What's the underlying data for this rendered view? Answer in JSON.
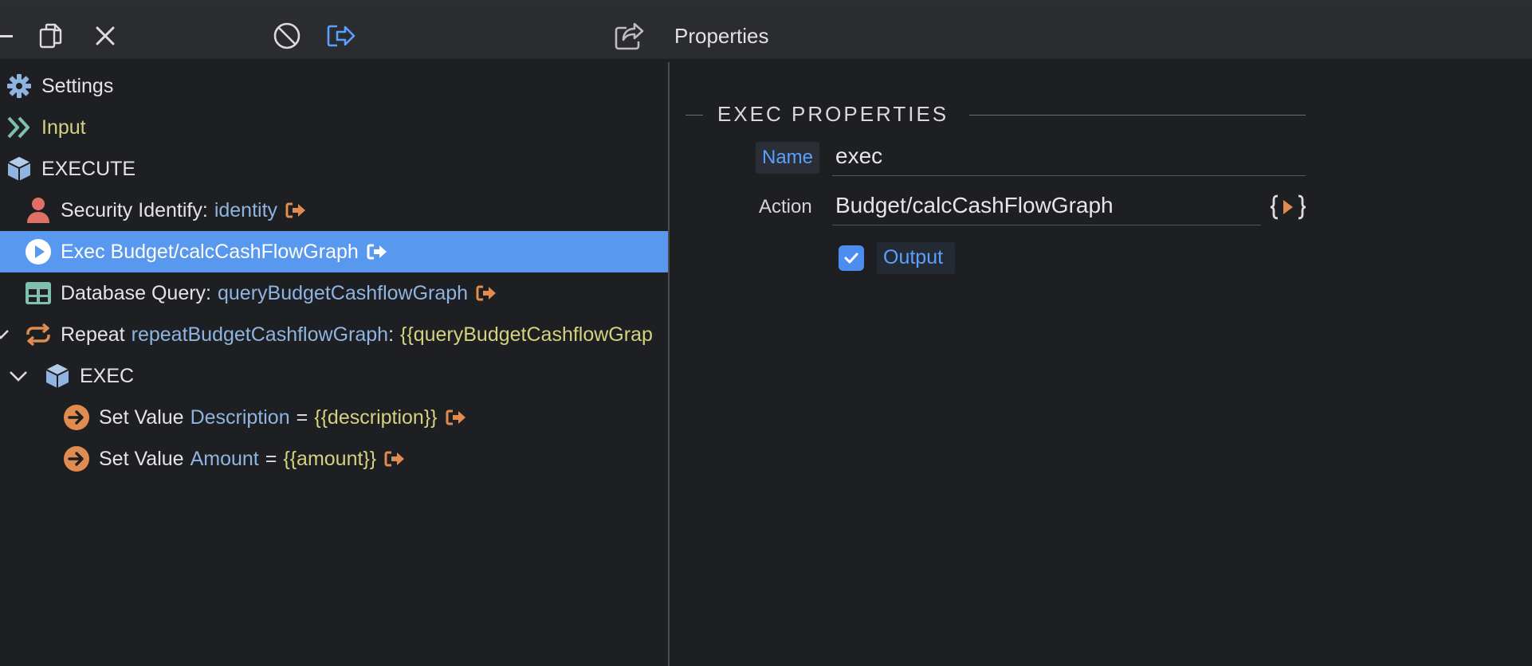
{
  "toolbar": {
    "icons": [
      "minus-icon",
      "copy-icon",
      "close-icon",
      "disable-icon",
      "export-icon",
      "share-icon"
    ],
    "properties_title": "Properties"
  },
  "tree": [
    {
      "label": "Settings",
      "icon": "gear-icon"
    },
    {
      "label": "Input",
      "icon": "double-chevron-right-icon"
    },
    {
      "label": "EXECUTE",
      "icon": "cube-icon"
    },
    {
      "label": "Security Identify:",
      "value": "identity",
      "icon": "user-icon"
    },
    {
      "label": "Exec Budget/calcCashFlowGraph",
      "icon": "play-circle-icon",
      "selected": true
    },
    {
      "label": "Database Query:",
      "value": "queryBudgetCashflowGraph",
      "icon": "table-icon"
    },
    {
      "label": "Repeat",
      "value": "repeatBudgetCashflowGraph",
      "sep": ":",
      "value2": "{{queryBudgetCashflowGrap",
      "icon": "repeat-icon"
    },
    {
      "label": "EXEC",
      "icon": "cube-icon"
    },
    {
      "label": "Set Value",
      "value": "Description",
      "sep": "=",
      "value2": "{{description}}",
      "icon": "arrow-circle-right-icon"
    },
    {
      "label": "Set Value",
      "value": "Amount",
      "sep": "=",
      "value2": "{{amount}}",
      "icon": "arrow-circle-right-icon"
    }
  ],
  "properties": {
    "section_title": "EXEC PROPERTIES",
    "name_label": "Name",
    "name_value": "exec",
    "action_label": "Action",
    "action_value": "Budget/calcCashFlowGraph",
    "code_button": "{ }",
    "output_label": "Output",
    "output_checked": true
  },
  "colors": {
    "selected_row": "#5898ef",
    "accent_blue": "#5aa0ff",
    "value_blue": "#8fb4e0",
    "value_yellow": "#d4d27e",
    "icon_orange": "#e08b4f",
    "icon_red": "#e07067",
    "icon_green": "#7fbfb0"
  }
}
